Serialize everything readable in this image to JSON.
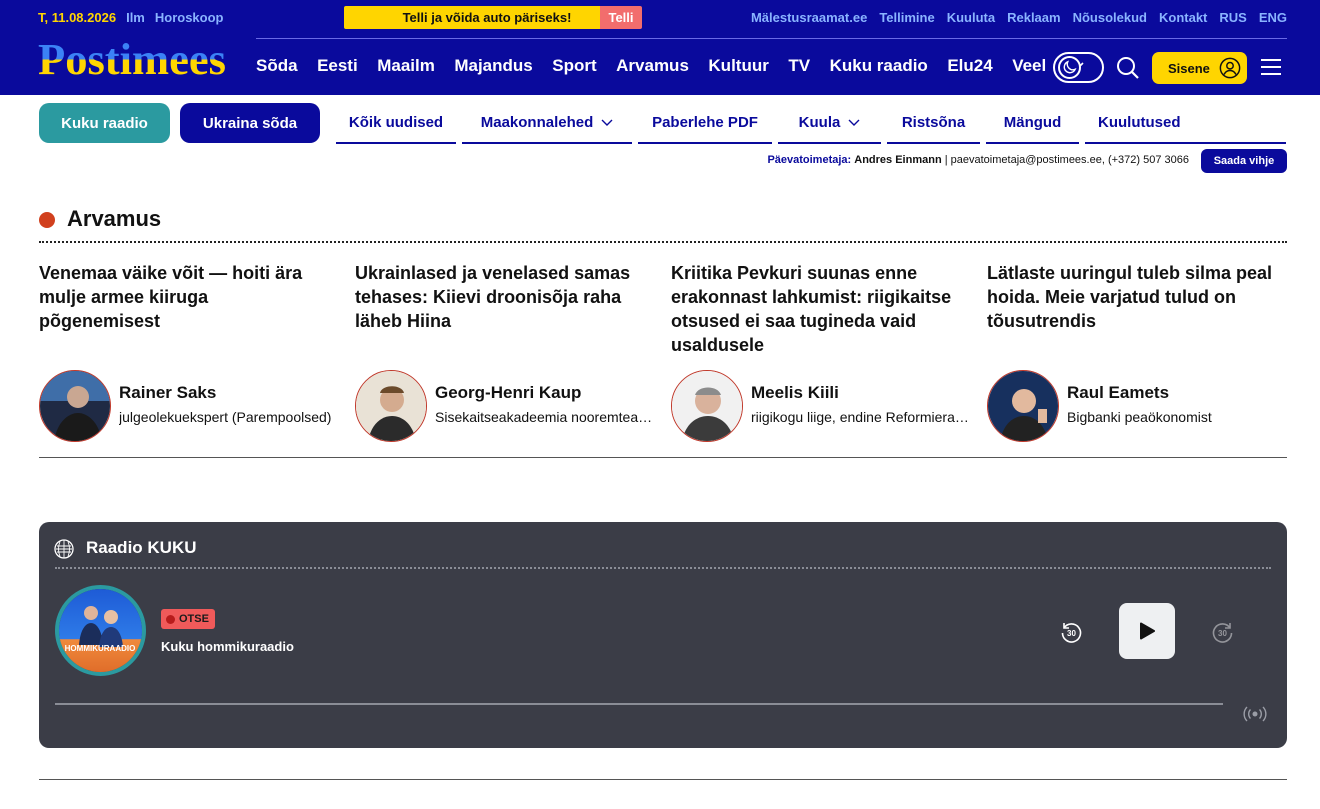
{
  "topbar": {
    "date": "T, 11.08.2026",
    "links_left": [
      "Ilm",
      "Horoskoop"
    ],
    "promo_text": "Telli ja võida auto päriseks!",
    "promo_button": "Telli",
    "links_right": [
      "Mälestusraamat.ee",
      "Tellimine",
      "Kuuluta",
      "Reklaam",
      "Nõusolekud",
      "Kontakt",
      "RUS",
      "ENG"
    ]
  },
  "logo": {
    "text": "Postimees"
  },
  "main_nav": {
    "items": [
      "Sõda",
      "Eesti",
      "Maailm",
      "Majandus",
      "Sport",
      "Arvamus",
      "Kultuur",
      "TV",
      "Kuku raadio",
      "Elu24"
    ],
    "more": "Veel"
  },
  "header_actions": {
    "signin": "Sisene"
  },
  "pills": {
    "kuku": "Kuku raadio",
    "ukraine": "Ukraina sõda"
  },
  "subnav": {
    "items": [
      "Kõik uudised",
      "Maakonnalehed",
      "Paberlehe PDF",
      "Kuula",
      "Ristsõna",
      "Mängud",
      "Kuulutused"
    ]
  },
  "editor": {
    "label": "Päevatoimetaja:",
    "name": "Andres Einmann",
    "contact": "| paevatoimetaja@postimees.ee, (+372) 507 3066",
    "tip_button": "Saada vihje"
  },
  "section": {
    "title": "Arvamus",
    "articles": [
      {
        "headline": "Venemaa väike võit — hoiti ära mulje armee kiiruga põgenemisest",
        "author": "Rainer Saks",
        "role": "julgeolekuekspert (Parempoolsed)"
      },
      {
        "headline": "Ukrainlased ja venelased samas tehases: Kiievi droonisõja raha läheb Hiina",
        "author": "Georg-Henri Kaup",
        "role": "Sisekaitseakadeemia nooremteadur"
      },
      {
        "headline": "Kriitika Pevkuri suunas enne erakonnast lahkumist: riigikaitse otsused ei saa tugineda vaid usaldusele",
        "author": "Meelis Kiili",
        "role": "riigikogu liige, endine Reformierakondlane"
      },
      {
        "headline": "Lätlaste uuringul tuleb silma peal hoida. Meie varjatud tulud on tõusutrendis",
        "author": "Raul Eamets",
        "role": "Bigbanki peaökonomist"
      }
    ]
  },
  "radio": {
    "title": "Raadio KUKU",
    "cover_text": "HOMMIKURAADIO",
    "live_badge": "OTSE",
    "show": "Kuku hommikuraadio",
    "skip_seconds": "30"
  }
}
